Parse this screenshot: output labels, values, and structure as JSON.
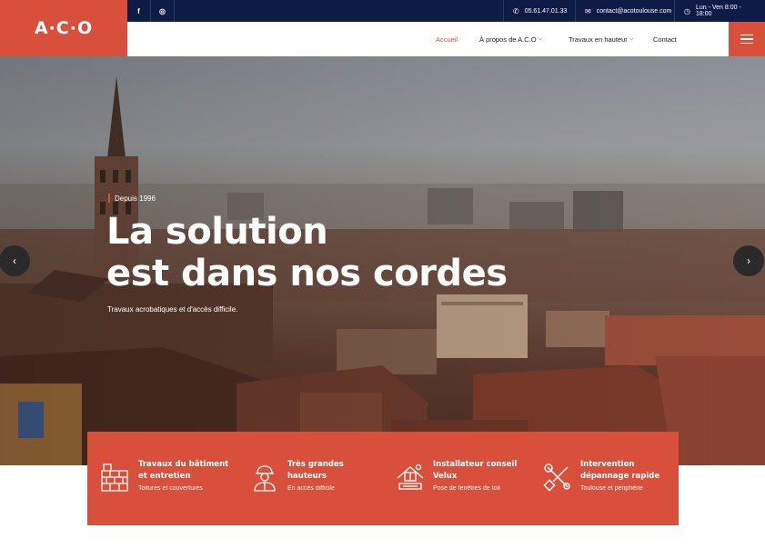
{
  "brand": {
    "logo_text": "A·C·O",
    "accent_color": "#d8503c",
    "dark_color": "#0e1b46"
  },
  "topbar": {
    "social": [
      {
        "name": "facebook-icon",
        "glyph": "f"
      },
      {
        "name": "instagram-icon",
        "glyph": "◎"
      }
    ],
    "phone": "05.61.47.01.33",
    "email": "contact@acotoulouse.com",
    "hours": "Lun - Ven 8:00 - 18:00"
  },
  "nav": {
    "items": [
      {
        "label": "Accueil",
        "active": true,
        "dropdown": false
      },
      {
        "label": "À propos de A.C.O",
        "active": false,
        "dropdown": true
      },
      {
        "label": "Travaux en hauteur",
        "active": false,
        "dropdown": true
      },
      {
        "label": "Contact",
        "active": false,
        "dropdown": false
      }
    ]
  },
  "hero": {
    "eyebrow": "Depuis 1996",
    "headline_line1": "La solution",
    "headline_line2": "est dans nos cordes",
    "subtitle": "Travaux acrobatiques et d'accès difficile.",
    "prev_glyph": "‹",
    "next_glyph": "›"
  },
  "services": [
    {
      "icon": "brick-wall-icon",
      "title_line1": "Travaux du bâtiment",
      "title_line2": "et entretien",
      "subtitle": "Toitures et couvertures"
    },
    {
      "icon": "worker-helmet-icon",
      "title_line1": "Très grandes",
      "title_line2": "hauteurs",
      "subtitle": "En accès difficile"
    },
    {
      "icon": "roof-window-icon",
      "title_line1": "Installateur conseil",
      "title_line2": "Velux",
      "subtitle": "Pose de fenêtres de toit"
    },
    {
      "icon": "wrench-screwdriver-icon",
      "title_line1": "Intervention",
      "title_line2": "dépannage rapide",
      "subtitle": "Toulouse et périphérie"
    }
  ]
}
